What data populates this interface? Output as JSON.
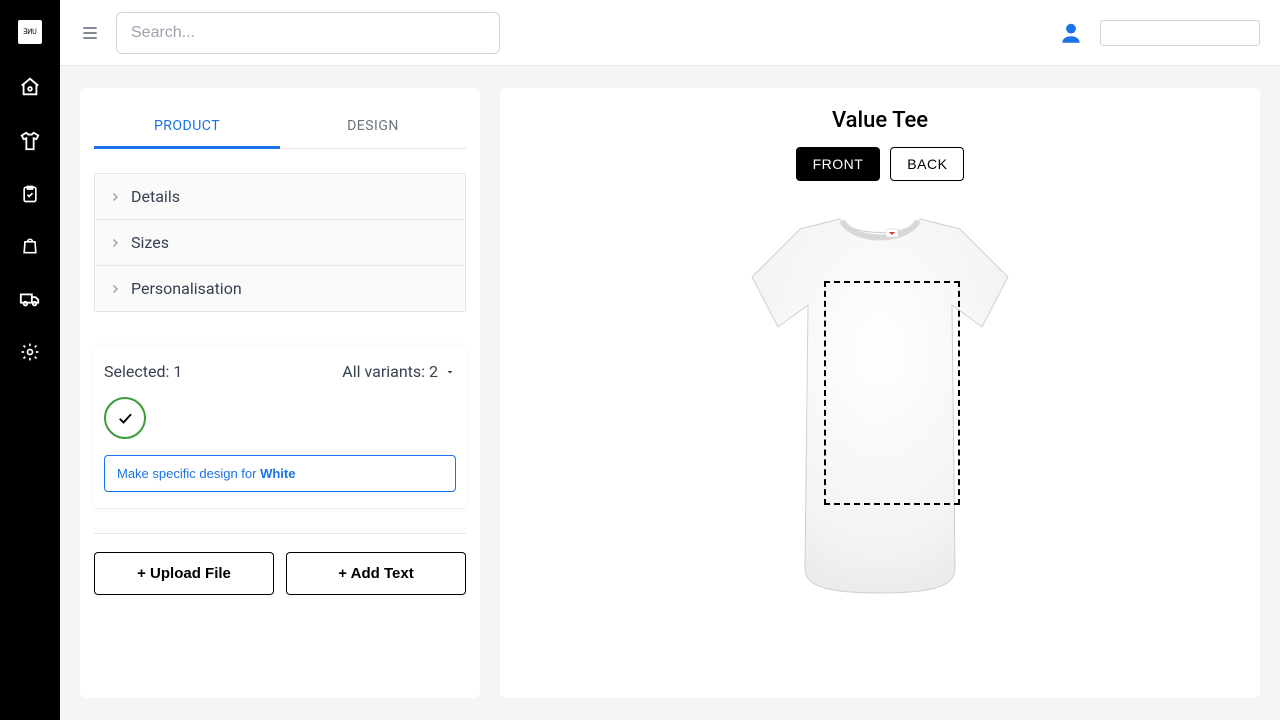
{
  "header": {
    "search_placeholder": "Search..."
  },
  "tabs": {
    "product": "PRODUCT",
    "design": "DESIGN"
  },
  "accordion": {
    "details": "Details",
    "sizes": "Sizes",
    "personalisation": "Personalisation"
  },
  "variants": {
    "selected_label": "Selected: 1",
    "all_label": "All variants: 2",
    "specific_prefix": "Make specific design for ",
    "specific_color": "White"
  },
  "actions": {
    "upload": "+ Upload File",
    "add_text": "+ Add Text"
  },
  "product": {
    "title": "Value Tee",
    "front": "FRONT",
    "back": "BACK"
  }
}
